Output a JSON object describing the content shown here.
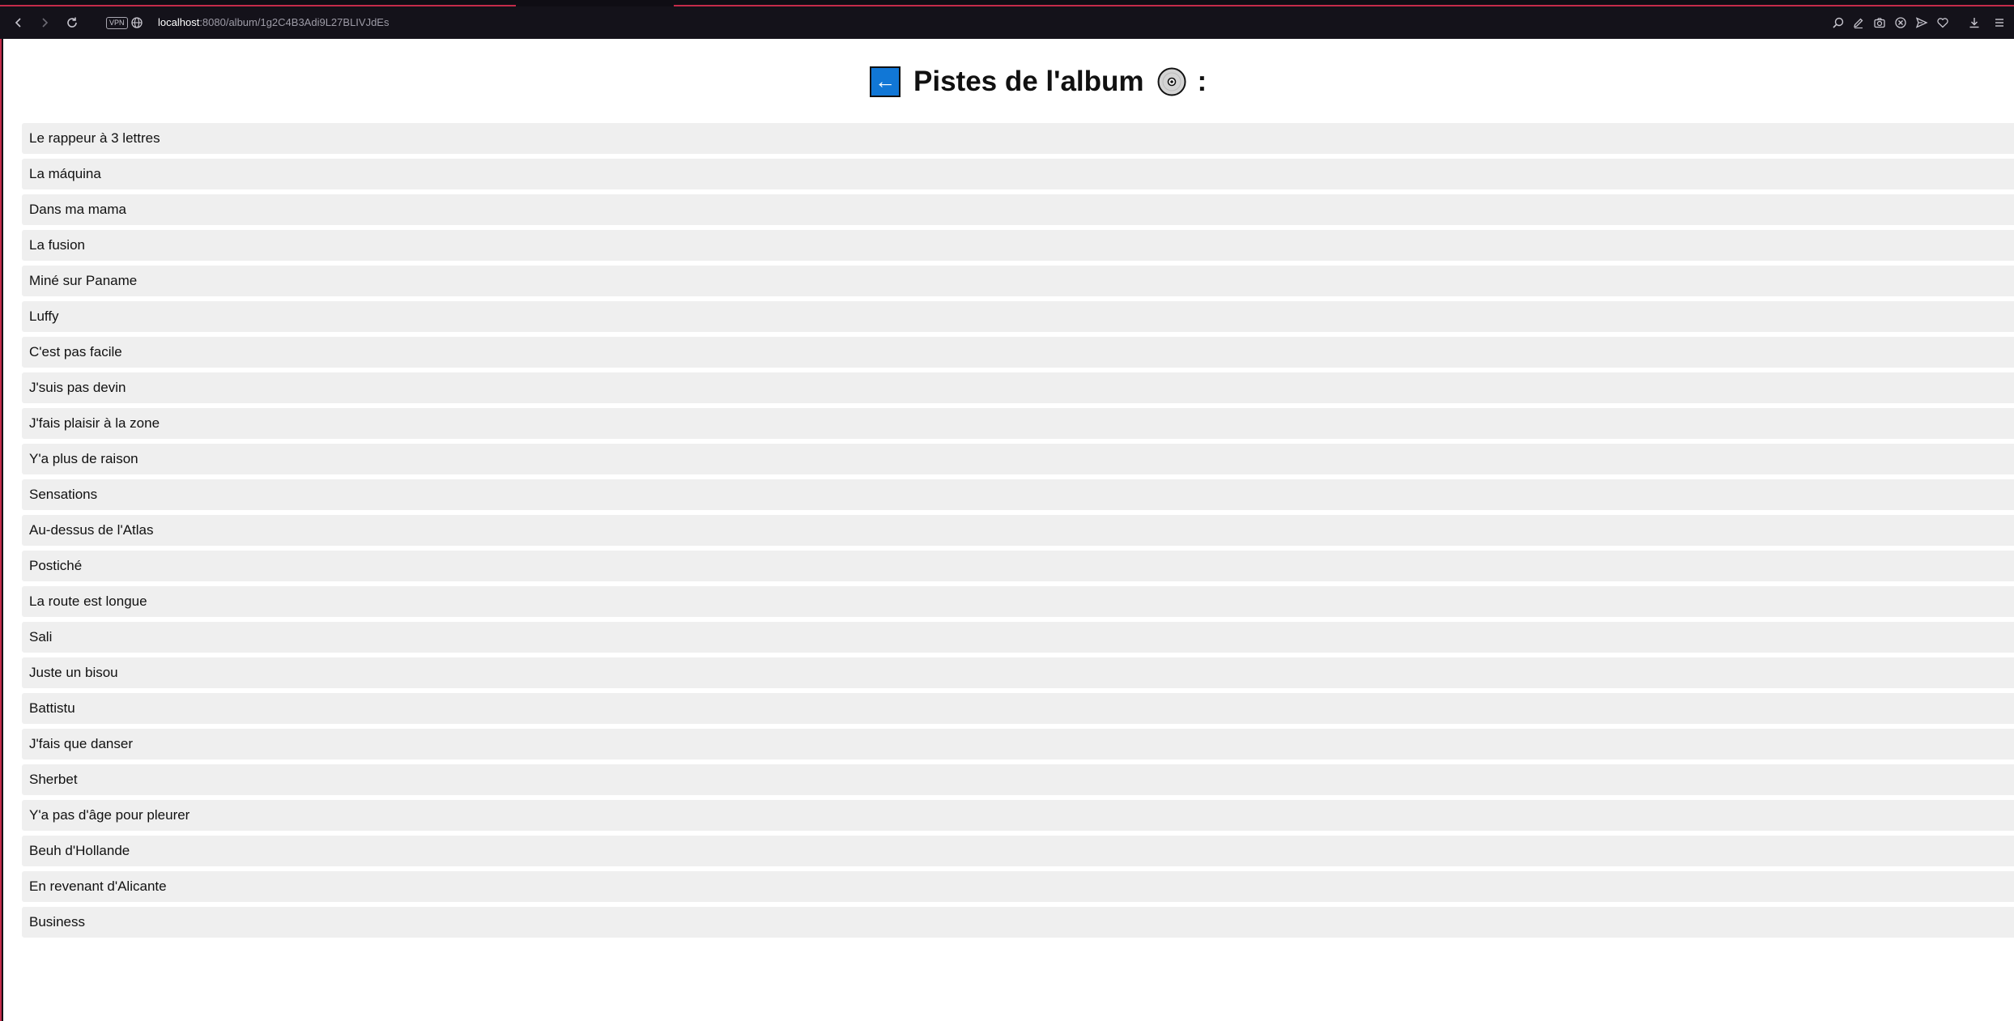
{
  "browser": {
    "url_host": "localhost",
    "url_rest": ":8080/album/1g2C4B3Adi9L27BLIVJdEs",
    "vpn_label": "VPN"
  },
  "page": {
    "back_label": "←",
    "title": "Pistes de l'album",
    "colon": ":",
    "tracks": [
      "Le rappeur à 3 lettres",
      "La máquina",
      "Dans ma mama",
      "La fusion",
      "Miné sur Paname",
      "Luffy",
      "C'est pas facile",
      "J'suis pas devin",
      "J'fais plaisir à la zone",
      "Y'a plus de raison",
      "Sensations",
      "Au-dessus de l'Atlas",
      "Postiché",
      "La route est longue",
      "Sali",
      "Juste un bisou",
      "Battistu",
      "J'fais que danser",
      "Sherbet",
      "Y'a pas d'âge pour pleurer",
      "Beuh d'Hollande",
      "En revenant d'Alicante",
      "Business"
    ]
  }
}
